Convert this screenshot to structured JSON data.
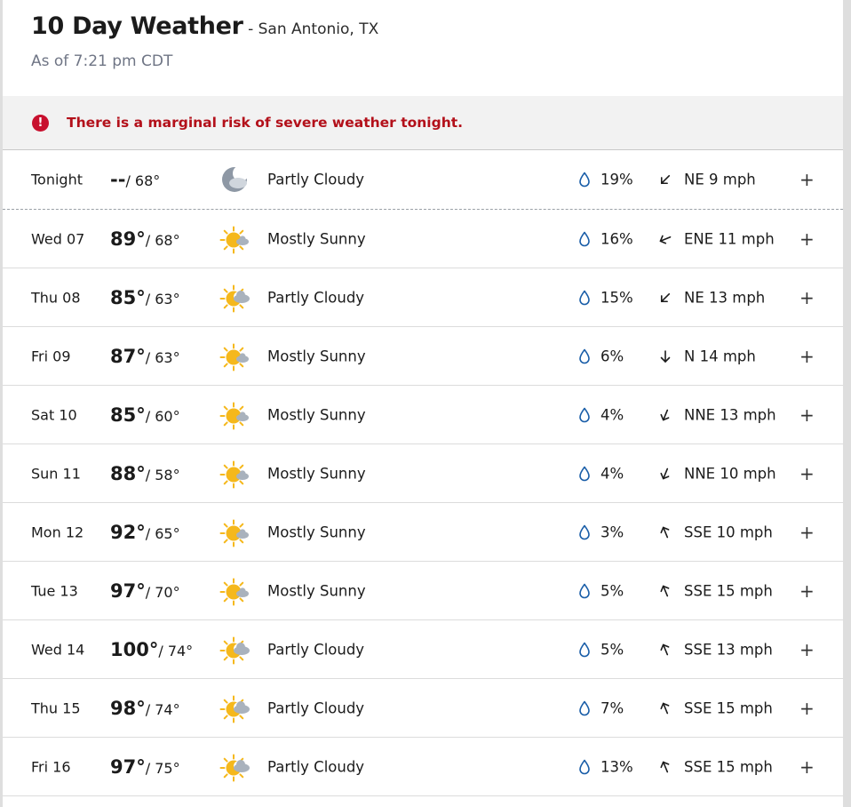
{
  "header": {
    "title": "10 Day Weather",
    "location": " - San Antonio, TX",
    "as_of": "As of 7:21 pm CDT"
  },
  "alert": {
    "icon": "exclamation-icon",
    "text": "There is a marginal risk of severe weather tonight.",
    "icon_glyph": "!",
    "color": "#b3101a"
  },
  "days": [
    {
      "day": "Tonight",
      "high": "--",
      "low": "/ 68°",
      "icon": "moon-icon",
      "condition": "Partly Cloudy",
      "precip": "19%",
      "wind_dir": "NE",
      "wind": "NE 9 mph",
      "expand": "+"
    },
    {
      "day": "Wed 07",
      "high": "89°",
      "low": "/ 68°",
      "icon": "mostly-sunny-icon",
      "condition": "Mostly Sunny",
      "precip": "16%",
      "wind_dir": "ENE",
      "wind": "ENE 11 mph",
      "expand": "+"
    },
    {
      "day": "Thu 08",
      "high": "85°",
      "low": "/ 63°",
      "icon": "partly-cloudy-icon",
      "condition": "Partly Cloudy",
      "precip": "15%",
      "wind_dir": "NE",
      "wind": "NE 13 mph",
      "expand": "+"
    },
    {
      "day": "Fri 09",
      "high": "87°",
      "low": "/ 63°",
      "icon": "mostly-sunny-icon",
      "condition": "Mostly Sunny",
      "precip": "6%",
      "wind_dir": "N",
      "wind": "N 14 mph",
      "expand": "+"
    },
    {
      "day": "Sat 10",
      "high": "85°",
      "low": "/ 60°",
      "icon": "mostly-sunny-icon",
      "condition": "Mostly Sunny",
      "precip": "4%",
      "wind_dir": "NNE",
      "wind": "NNE 13 mph",
      "expand": "+"
    },
    {
      "day": "Sun 11",
      "high": "88°",
      "low": "/ 58°",
      "icon": "mostly-sunny-icon",
      "condition": "Mostly Sunny",
      "precip": "4%",
      "wind_dir": "NNE",
      "wind": "NNE 10 mph",
      "expand": "+"
    },
    {
      "day": "Mon 12",
      "high": "92°",
      "low": "/ 65°",
      "icon": "mostly-sunny-icon",
      "condition": "Mostly Sunny",
      "precip": "3%",
      "wind_dir": "SSE",
      "wind": "SSE 10 mph",
      "expand": "+"
    },
    {
      "day": "Tue 13",
      "high": "97°",
      "low": "/ 70°",
      "icon": "mostly-sunny-icon",
      "condition": "Mostly Sunny",
      "precip": "5%",
      "wind_dir": "SSE",
      "wind": "SSE 15 mph",
      "expand": "+"
    },
    {
      "day": "Wed 14",
      "high": "100°",
      "low": "/ 74°",
      "icon": "partly-cloudy-icon",
      "condition": "Partly Cloudy",
      "precip": "5%",
      "wind_dir": "SSE",
      "wind": "SSE 13 mph",
      "expand": "+"
    },
    {
      "day": "Thu 15",
      "high": "98°",
      "low": "/ 74°",
      "icon": "partly-cloudy-icon",
      "condition": "Partly Cloudy",
      "precip": "7%",
      "wind_dir": "SSE",
      "wind": "SSE 15 mph",
      "expand": "+"
    },
    {
      "day": "Fri 16",
      "high": "97°",
      "low": "/ 75°",
      "icon": "partly-cloudy-icon",
      "condition": "Partly Cloudy",
      "precip": "13%",
      "wind_dir": "SSE",
      "wind": "SSE 15 mph",
      "expand": "+"
    }
  ],
  "colors": {
    "sun": "#f5b81c",
    "cloud": "#a9b2bd",
    "moon": "#8e98a5",
    "drop": "#1a5ea8",
    "alert_red": "#c8102e"
  }
}
